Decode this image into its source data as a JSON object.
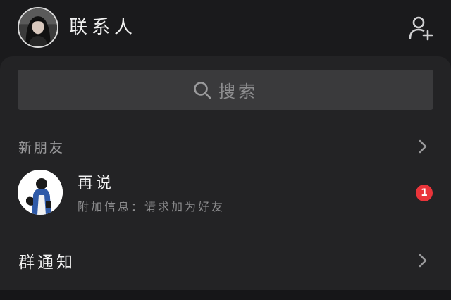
{
  "header": {
    "title": "联系人",
    "avatar_icon": "user-avatar",
    "add_icon": "add-contact-icon"
  },
  "search": {
    "placeholder": "搜索",
    "icon": "search-icon"
  },
  "new_friends": {
    "label": "新朋友",
    "icon": "chevron-right-icon"
  },
  "friend_request": {
    "name": "再说",
    "subtitle": "附加信息：请求加为好友",
    "badge": "1",
    "badge_color": "#e9343a"
  },
  "group_notice": {
    "label": "群通知",
    "icon": "chevron-right-icon"
  },
  "colors": {
    "background": "#1a1a1c",
    "panel": "#232325",
    "search_bg": "#3a3a3c"
  }
}
